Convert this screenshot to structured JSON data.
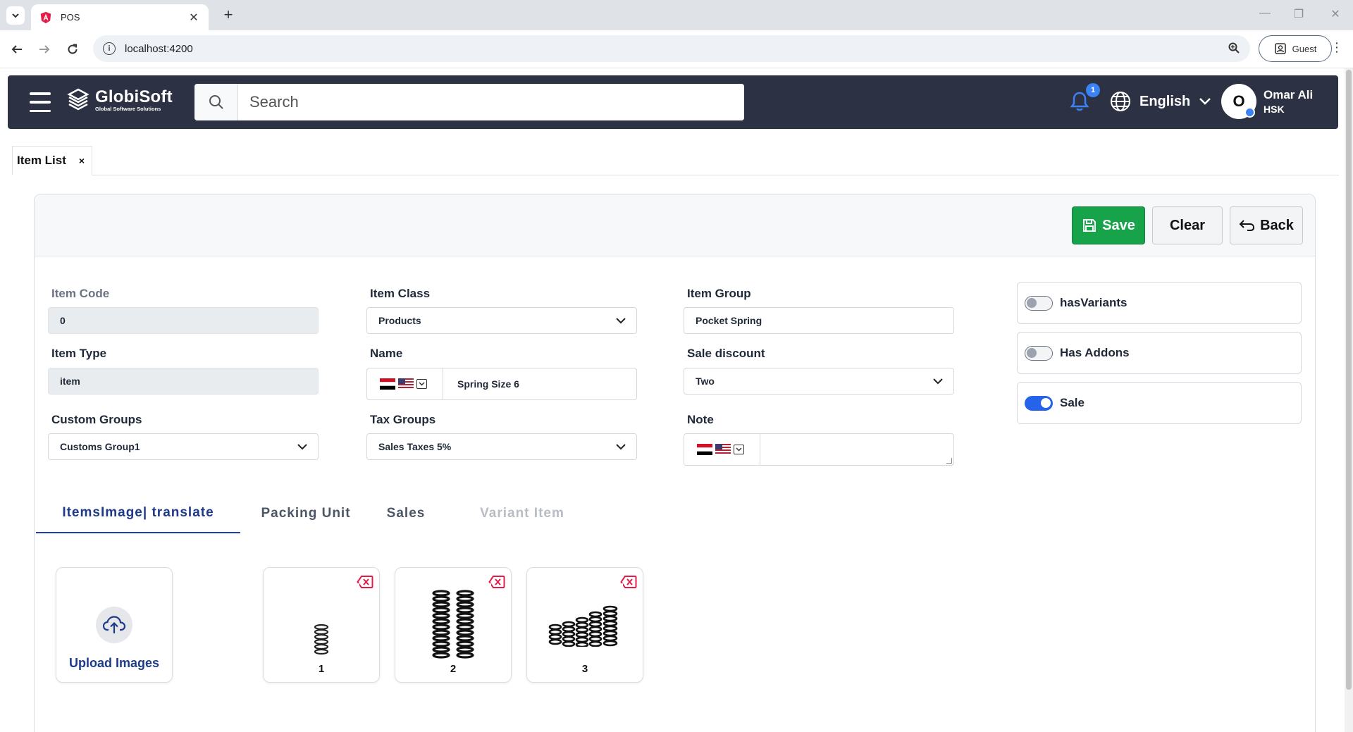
{
  "browser": {
    "tab_title": "POS",
    "url": "localhost:4200",
    "profile_label": "Guest"
  },
  "header": {
    "brand_name": "GlobiSoft",
    "brand_tagline": "Global Software Solutions",
    "search_placeholder": "Search",
    "notification_count": "1",
    "language": "English",
    "user_initial": "O",
    "user_name": "Omar Ali",
    "user_company": "HSK"
  },
  "page_tabs": [
    {
      "label": "Item List",
      "close": "×"
    }
  ],
  "toolbar": {
    "save_label": "Save",
    "clear_label": "Clear",
    "back_label": "Back"
  },
  "form": {
    "item_code": {
      "label": "Item Code",
      "value": "0"
    },
    "item_class": {
      "label": "Item Class",
      "value": "Products"
    },
    "item_group": {
      "label": "Item Group",
      "value": "Pocket Spring"
    },
    "item_type": {
      "label": "Item Type",
      "value": "item"
    },
    "name": {
      "label": "Name",
      "value": "Spring Size 6"
    },
    "sale_discount": {
      "label": "Sale discount",
      "value": "Two"
    },
    "custom_groups": {
      "label": "Custom Groups",
      "value": "Customs Group1"
    },
    "tax_groups": {
      "label": "Tax Groups",
      "value": "Sales Taxes 5%"
    },
    "note": {
      "label": "Note",
      "value": ""
    }
  },
  "toggles": [
    {
      "label": "hasVariants",
      "on": false
    },
    {
      "label": "Has Addons",
      "on": false
    },
    {
      "label": "Sale",
      "on": true
    }
  ],
  "sub_tabs": [
    {
      "label": "ItemsImage| translate",
      "state": "active"
    },
    {
      "label": "Packing Unit",
      "state": "normal"
    },
    {
      "label": "Sales",
      "state": "normal"
    },
    {
      "label": "Variant Item",
      "state": "disabled"
    }
  ],
  "upload_label": "Upload Images",
  "images": [
    {
      "number": "1"
    },
    {
      "number": "2"
    },
    {
      "number": "3"
    }
  ],
  "colors": {
    "header_bg": "#2c3243",
    "save_green": "#16a34a",
    "accent_blue": "#1e3a8a",
    "toggle_on": "#2563eb"
  }
}
